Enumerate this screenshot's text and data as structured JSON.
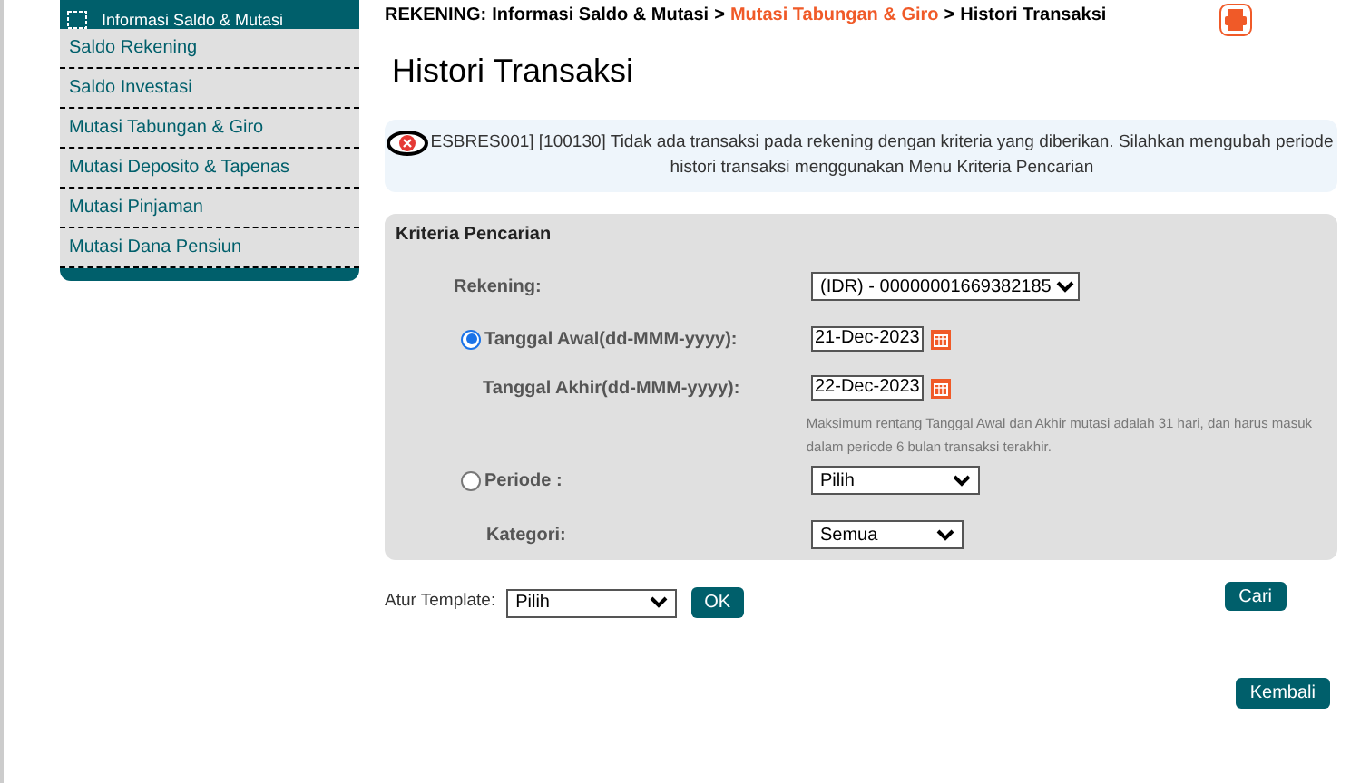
{
  "sidebar": {
    "header": "Informasi Saldo & Mutasi",
    "items": [
      {
        "label": "Saldo Rekening",
        "selected": false
      },
      {
        "label": "Saldo Investasi",
        "selected": false
      },
      {
        "label": "Mutasi Tabungan & Giro",
        "selected": false
      },
      {
        "label": "Mutasi Deposito & Tapenas",
        "selected": false
      },
      {
        "label": "Mutasi Pinjaman",
        "selected": false
      },
      {
        "label": "Mutasi Dana Pensiun",
        "selected": false
      }
    ]
  },
  "breadcrumb": [
    {
      "label": "REKENING:",
      "kind": "root"
    },
    {
      "label": "Informasi Saldo & Mutasi",
      "kind": "plain"
    },
    {
      "label": ">",
      "kind": "sep"
    },
    {
      "label": "Mutasi Tabungan & Giro",
      "kind": "link"
    },
    {
      "label": ">",
      "kind": "sep"
    },
    {
      "label": "Histori Transaksi",
      "kind": "plain"
    }
  ],
  "title": "Histori Transaksi",
  "alert": {
    "text": "ESBRES001] [100130] Tidak ada transaksi pada rekening dengan kriteria yang diberikan. Silahkan mengubah periode histori transaksi menggunakan Menu Kriteria Pencarian"
  },
  "criteria": {
    "title": "Kriteria Pencarian",
    "rekening": {
      "label": "Rekening:",
      "value": "(IDR) - 00000001669382185"
    },
    "start": {
      "label": "Tanggal Awal(dd-MMM-yyyy):",
      "selected": true,
      "value": "21-Dec-2023"
    },
    "end": {
      "label": "Tanggal Akhir(dd-MMM-yyyy):",
      "value": "22-Dec-2023"
    },
    "note": "Maksimum rentang Tanggal Awal dan Akhir mutasi adalah 31 hari, dan harus masuk dalam periode 6 bulan transaksi terakhir.",
    "periode": {
      "label": "Periode :",
      "selected": false,
      "value": "Pilih"
    },
    "kategori": {
      "label": "Kategori:",
      "value": "Semua"
    }
  },
  "template": {
    "label": "Atur Template:",
    "value": "Pilih",
    "button": "OK"
  },
  "search_button": "Cari",
  "back_button": "Kembali"
}
